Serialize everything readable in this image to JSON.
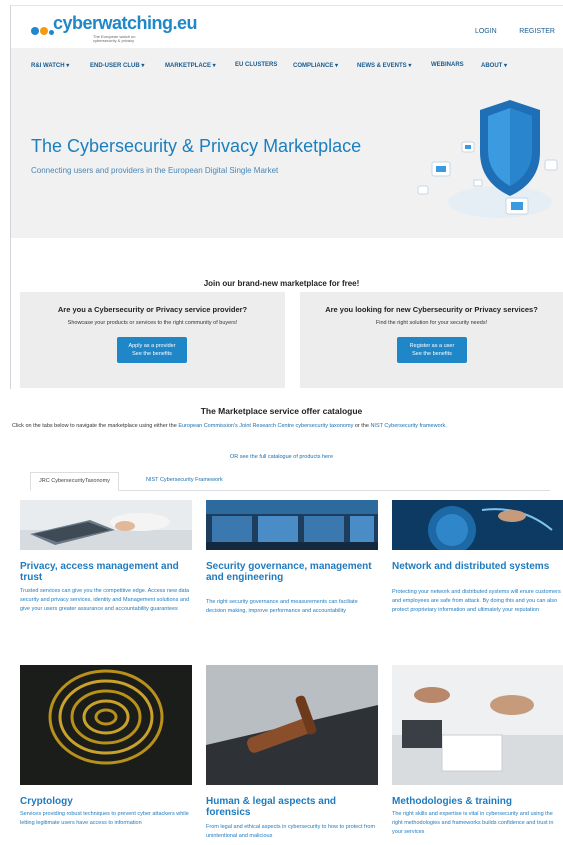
{
  "header": {
    "logo_text": "cyberwatching.eu",
    "logo_subtitle": "The European watch on cybersecurity & privacy",
    "login": "LOGIN",
    "register": "REGISTER"
  },
  "nav": [
    "R&I WATCH",
    "END-USER CLUB",
    "MARKETPLACE",
    "EU CLUSTERS",
    "COMPLIANCE",
    "NEWS & EVENTS",
    "WEBINARS",
    "ABOUT"
  ],
  "hero": {
    "title": "The Cybersecurity & Privacy Marketplace",
    "subtitle": "Connecting users and providers in the European Digital Single Market"
  },
  "join": {
    "title": "Join our brand-new marketplace for free!",
    "provider": {
      "heading": "Are you a Cybersecurity or Privacy service provider?",
      "text": "Showcase your products or services to the right community of buyers!",
      "button_line1": "Apply as a provider",
      "button_line2": "See the benefits"
    },
    "user": {
      "heading": "Are you looking for new Cybersecurity or Privacy services?",
      "text": "Find the right solution for your security needs!",
      "button_line1": "Register as a user",
      "button_line2": "See the benefits"
    }
  },
  "catalogue": {
    "title": "The Marketplace service offer catalogue",
    "desc_pre": "Click on the tabs below to navigate the marketplace using either the ",
    "desc_link1": "European Commission's Joint Research Centre cybersecurity taxonomy",
    "desc_mid": " or the ",
    "desc_link2": "NIST Cybersecurity framework",
    "desc_post": ".",
    "or_link": "OR see the full catalogue of products here",
    "tabs": [
      "JRC CybersecurityTaxonomy",
      "NIST Cybersecurity Framework"
    ]
  },
  "cards": [
    {
      "title": "Privacy, access management and trust",
      "text": "Trusted services can give you the competitive edge. Access new data security and privacy services, identity and Management solutions and give your users greater assurance and accountability guarantees"
    },
    {
      "title": "Security governance, management and engineering",
      "text": "The right security governance and measurements can faciliate decision making, improve performance and accountability"
    },
    {
      "title": "Network and distributed systems",
      "text": "Protecting your network and distributed systems will enure customers and employees are safe from attack. By doing this and you can also protect proprietary information and ultimately your reputation"
    },
    {
      "title": "Cryptology",
      "text": "Services providing robust techniques to prevent cyber attackers while letting legitimate users have access to information"
    },
    {
      "title": "Human & legal aspects and forensics",
      "text": "From legal and ethical aspects in cybersecurity to how to protect from unintentional and malicious"
    },
    {
      "title": "Methodologies & training",
      "text": "The right skills and expertise is vital in cybersecurity and using the right methodologies and frameworks builds confidence and trust in your services"
    }
  ],
  "colors": {
    "accent": "#1f86c8",
    "link": "#1a6fb0",
    "logo_orange": "#f39c12"
  }
}
